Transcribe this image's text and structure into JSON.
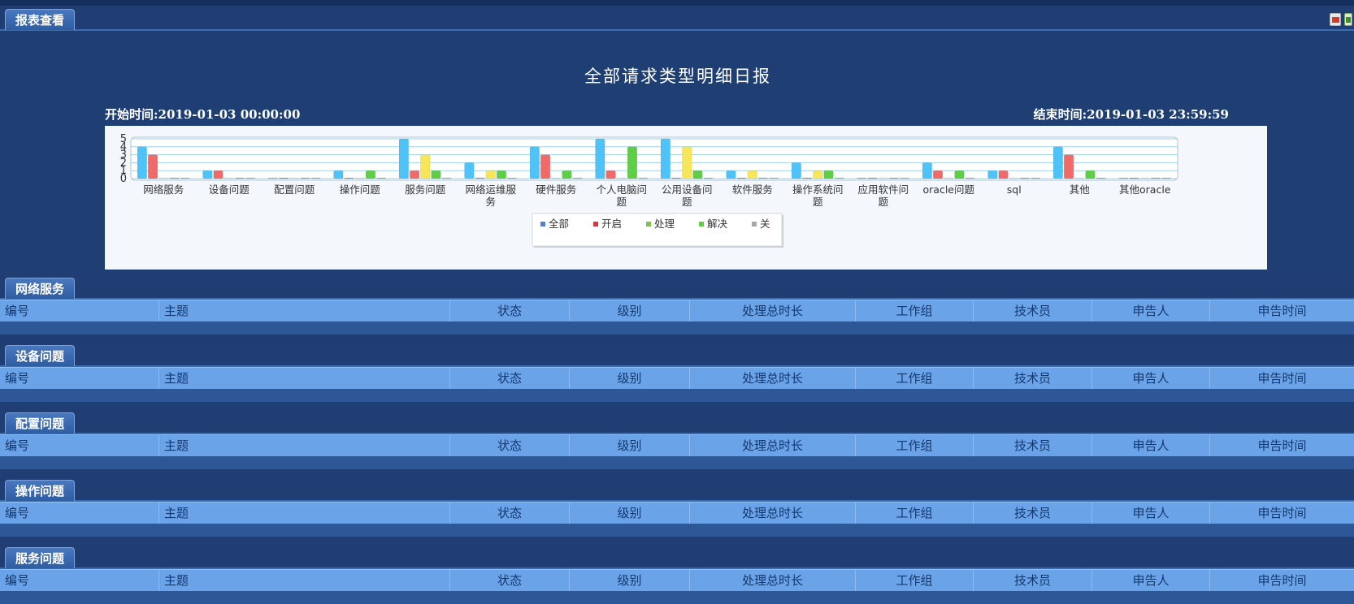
{
  "main_tab": "报表查看",
  "toolbar": {
    "pdf_icon": "pdf-export-icon",
    "excel_icon": "excel-export-icon"
  },
  "report": {
    "title": "全部请求类型明细日报",
    "start_time": "开始时间:2019-01-03 00:00:00",
    "end_time": "结束时间:2019-01-03 23:59:59"
  },
  "chart_data": {
    "type": "bar",
    "title": "",
    "xlabel": "",
    "ylabel": "",
    "ylim": [
      0,
      5
    ],
    "yticks": [
      "0",
      "1",
      "2",
      "3",
      "4",
      "5"
    ],
    "grid": true,
    "legend_position": "bottom",
    "categories": [
      [
        "网络服务"
      ],
      [
        "设备问题"
      ],
      [
        "配置问题"
      ],
      [
        "操作问题"
      ],
      [
        "服务问题"
      ],
      [
        "网络运维服",
        "务"
      ],
      [
        "硬件服务"
      ],
      [
        "个人电脑问",
        "题"
      ],
      [
        "公用设备问",
        "题"
      ],
      [
        "软件服务"
      ],
      [
        "操作系统问",
        "题"
      ],
      [
        "应用软件问",
        "题"
      ],
      [
        "oracle问题"
      ],
      [
        "sql"
      ],
      [
        "其他"
      ],
      [
        "其他oracle"
      ]
    ],
    "series": [
      {
        "name": "全部",
        "color": "#4fc3f7",
        "legend_color": "#4f7fd9",
        "values": [
          4,
          1,
          0,
          1,
          5,
          2,
          4,
          5,
          5,
          1,
          2,
          0,
          2,
          1,
          4,
          0
        ]
      },
      {
        "name": "开启",
        "color": "#f06a6a",
        "legend_color": "#d9363e",
        "values": [
          3,
          1,
          0,
          0,
          1,
          0,
          3,
          1,
          0,
          0,
          0,
          0,
          1,
          1,
          3,
          0
        ]
      },
      {
        "name": "处理",
        "color": "#f7e55a",
        "legend_color": "#7fc450",
        "values": [
          0,
          0,
          0,
          0,
          3,
          1,
          0,
          0,
          4,
          1,
          1,
          0,
          0,
          0,
          0,
          0
        ]
      },
      {
        "name": "解决",
        "color": "#5fce46",
        "legend_color": "#5fce46",
        "values": [
          0,
          0,
          0,
          1,
          1,
          1,
          1,
          4,
          1,
          0,
          1,
          0,
          1,
          0,
          1,
          0
        ]
      },
      {
        "name": "关",
        "color": "#a8a8a8",
        "legend_color": "#a8a8a8",
        "values": [
          0,
          0,
          0,
          0,
          0,
          0,
          0,
          0,
          0,
          0,
          0,
          0,
          0,
          0,
          0,
          0
        ]
      }
    ]
  },
  "columns": [
    "编号",
    "主题",
    "状态",
    "级别",
    "处理总时长",
    "工作组",
    "技术员",
    "申告人",
    "申告时间"
  ],
  "sections": [
    {
      "title": "网络服务"
    },
    {
      "title": "设备问题"
    },
    {
      "title": "配置问题"
    },
    {
      "title": "操作问题"
    },
    {
      "title": "服务问题"
    }
  ]
}
